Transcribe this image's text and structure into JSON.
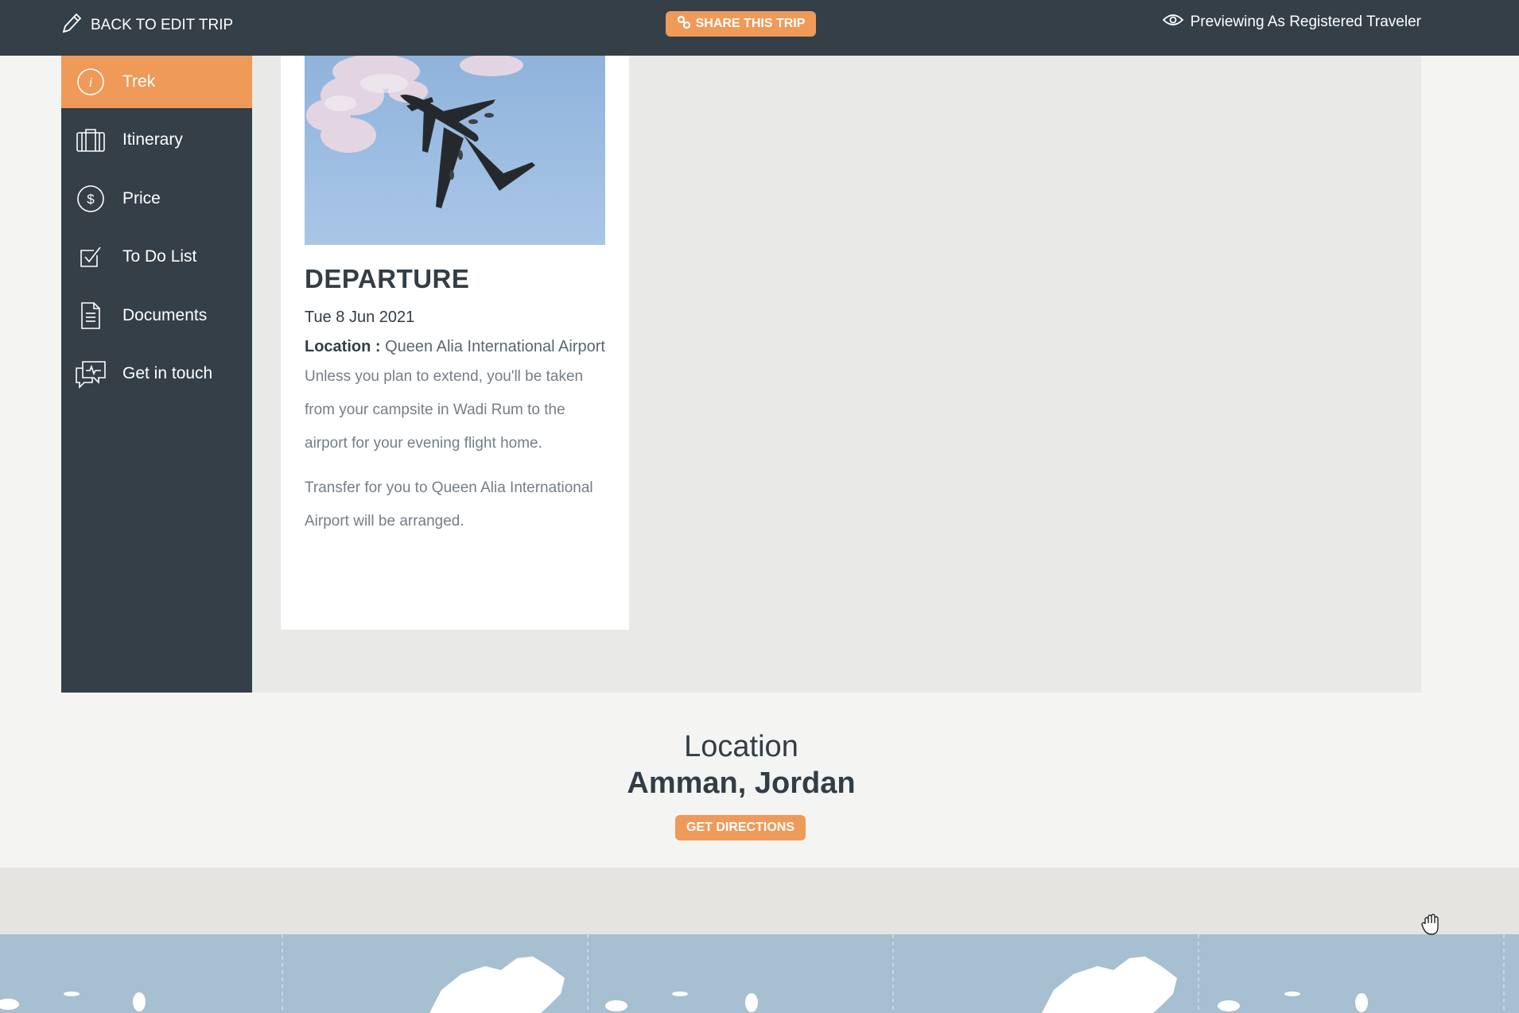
{
  "topbar": {
    "back_label": "BACK TO EDIT TRIP",
    "share_label": "SHARE THIS TRIP",
    "preview_label": "Previewing As Registered Traveler"
  },
  "sidebar": {
    "items": [
      {
        "label": "Trek",
        "icon": "info-icon",
        "active": true
      },
      {
        "label": "Itinerary",
        "icon": "suitcase-icon"
      },
      {
        "label": "Price",
        "icon": "dollar-icon"
      },
      {
        "label": "To Do List",
        "icon": "checkbox-icon"
      },
      {
        "label": "Documents",
        "icon": "document-icon"
      },
      {
        "label": "Get in touch",
        "icon": "chat-icon"
      }
    ]
  },
  "card": {
    "title": "DEPARTURE",
    "date": "Tue 8 Jun 2021",
    "location_label": "Location :",
    "location_value": "Queen Alia International Airport",
    "paragraph1": "Unless you plan to extend, you'll be taken from your campsite in Wadi Rum to the airport for your evening flight home.",
    "paragraph2": "Transfer for you to Queen Alia International Airport will be arranged."
  },
  "location_section": {
    "heading": "Location",
    "city": "Amman, Jordan",
    "directions_label": "GET DIRECTIONS"
  },
  "colors": {
    "accent": "#ef9a58",
    "dark": "#343f48",
    "panel_bg": "#e9eae8",
    "map_water": "#a6bfd1"
  }
}
